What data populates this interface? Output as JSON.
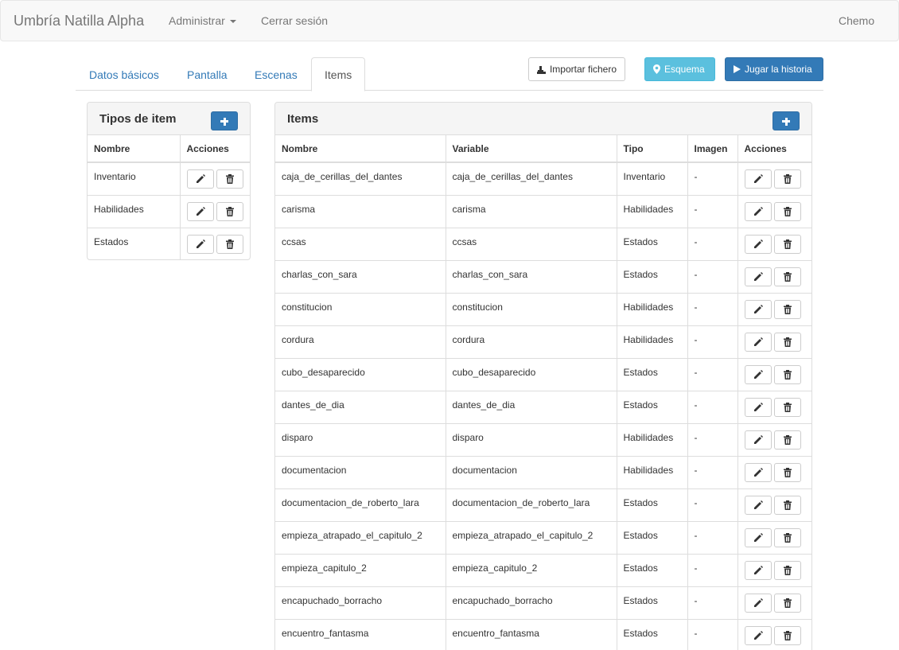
{
  "navbar": {
    "brand": "Umbría Natilla Alpha",
    "admin": "Administrar",
    "logout": "Cerrar sesión",
    "user": "Chemo"
  },
  "tabs": [
    {
      "label": "Datos básicos",
      "active": false
    },
    {
      "label": "Pantalla",
      "active": false
    },
    {
      "label": "Escenas",
      "active": false
    },
    {
      "label": "Items",
      "active": true
    }
  ],
  "toolbar": {
    "import": "Importar fichero",
    "schema": "Esquema",
    "play": "Jugar la historia"
  },
  "types_panel": {
    "title": "Tipos de item",
    "columns": [
      "Nombre",
      "Acciones"
    ],
    "rows": [
      "Inventario",
      "Habilidades",
      "Estados"
    ]
  },
  "items_panel": {
    "title": "Items",
    "columns": [
      "Nombre",
      "Variable",
      "Tipo",
      "Imagen",
      "Acciones"
    ],
    "rows": [
      {
        "nombre": "caja_de_cerillas_del_dantes",
        "variable": "caja_de_cerillas_del_dantes",
        "tipo": "Inventario",
        "imagen": "-"
      },
      {
        "nombre": "carisma",
        "variable": "carisma",
        "tipo": "Habilidades",
        "imagen": "-"
      },
      {
        "nombre": "ccsas",
        "variable": "ccsas",
        "tipo": "Estados",
        "imagen": "-"
      },
      {
        "nombre": "charlas_con_sara",
        "variable": "charlas_con_sara",
        "tipo": "Estados",
        "imagen": "-"
      },
      {
        "nombre": "constitucion",
        "variable": "constitucion",
        "tipo": "Habilidades",
        "imagen": "-"
      },
      {
        "nombre": "cordura",
        "variable": "cordura",
        "tipo": "Habilidades",
        "imagen": "-"
      },
      {
        "nombre": "cubo_desaparecido",
        "variable": "cubo_desaparecido",
        "tipo": "Estados",
        "imagen": "-"
      },
      {
        "nombre": "dantes_de_dia",
        "variable": "dantes_de_dia",
        "tipo": "Estados",
        "imagen": "-"
      },
      {
        "nombre": "disparo",
        "variable": "disparo",
        "tipo": "Habilidades",
        "imagen": "-"
      },
      {
        "nombre": "documentacion",
        "variable": "documentacion",
        "tipo": "Habilidades",
        "imagen": "-"
      },
      {
        "nombre": "documentacion_de_roberto_lara",
        "variable": "documentacion_de_roberto_lara",
        "tipo": "Estados",
        "imagen": "-"
      },
      {
        "nombre": "empieza_atrapado_el_capitulo_2",
        "variable": "empieza_atrapado_el_capitulo_2",
        "tipo": "Estados",
        "imagen": "-"
      },
      {
        "nombre": "empieza_capitulo_2",
        "variable": "empieza_capitulo_2",
        "tipo": "Estados",
        "imagen": "-"
      },
      {
        "nombre": "encapuchado_borracho",
        "variable": "encapuchado_borracho",
        "tipo": "Estados",
        "imagen": "-"
      },
      {
        "nombre": "encuentro_fantasma",
        "variable": "encuentro_fantasma",
        "tipo": "Estados",
        "imagen": "-"
      }
    ]
  }
}
